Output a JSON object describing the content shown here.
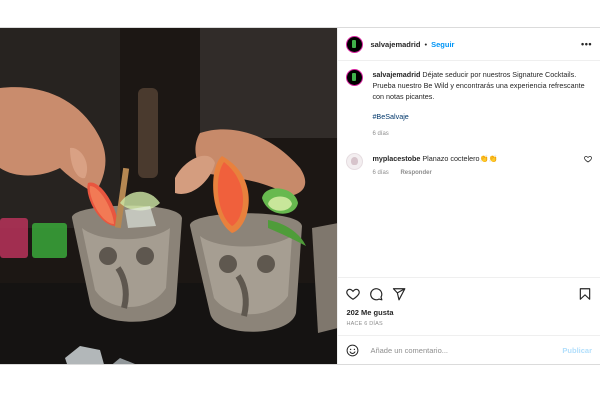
{
  "post": {
    "username": "salvajemadrid",
    "follow_label": "Seguir",
    "more_label": "•••",
    "separator": "•"
  },
  "caption": {
    "username": "salvajemadrid",
    "text": "Déjate seducir por nuestros Signature Cocktails. Prueba nuestro Be Wild y encontrarás una experiencia refrescante con notas picantes.",
    "hashtag": "#BeSalvaje",
    "age": "6 días"
  },
  "comment": {
    "username": "myplacestobe",
    "text": "Planazo coctelero👏👏",
    "age": "6 días",
    "reply_label": "Responder"
  },
  "actions": {
    "likes": "202 Me gusta",
    "posted_ago": "HACE 6 DÍAS"
  },
  "composer": {
    "placeholder": "Añade un comentario...",
    "publish_label": "Publicar"
  },
  "colors": {
    "accent_blue": "#0095f6",
    "publish_disabled": "#b2dffc",
    "meta_gray": "#8e8e8e"
  }
}
